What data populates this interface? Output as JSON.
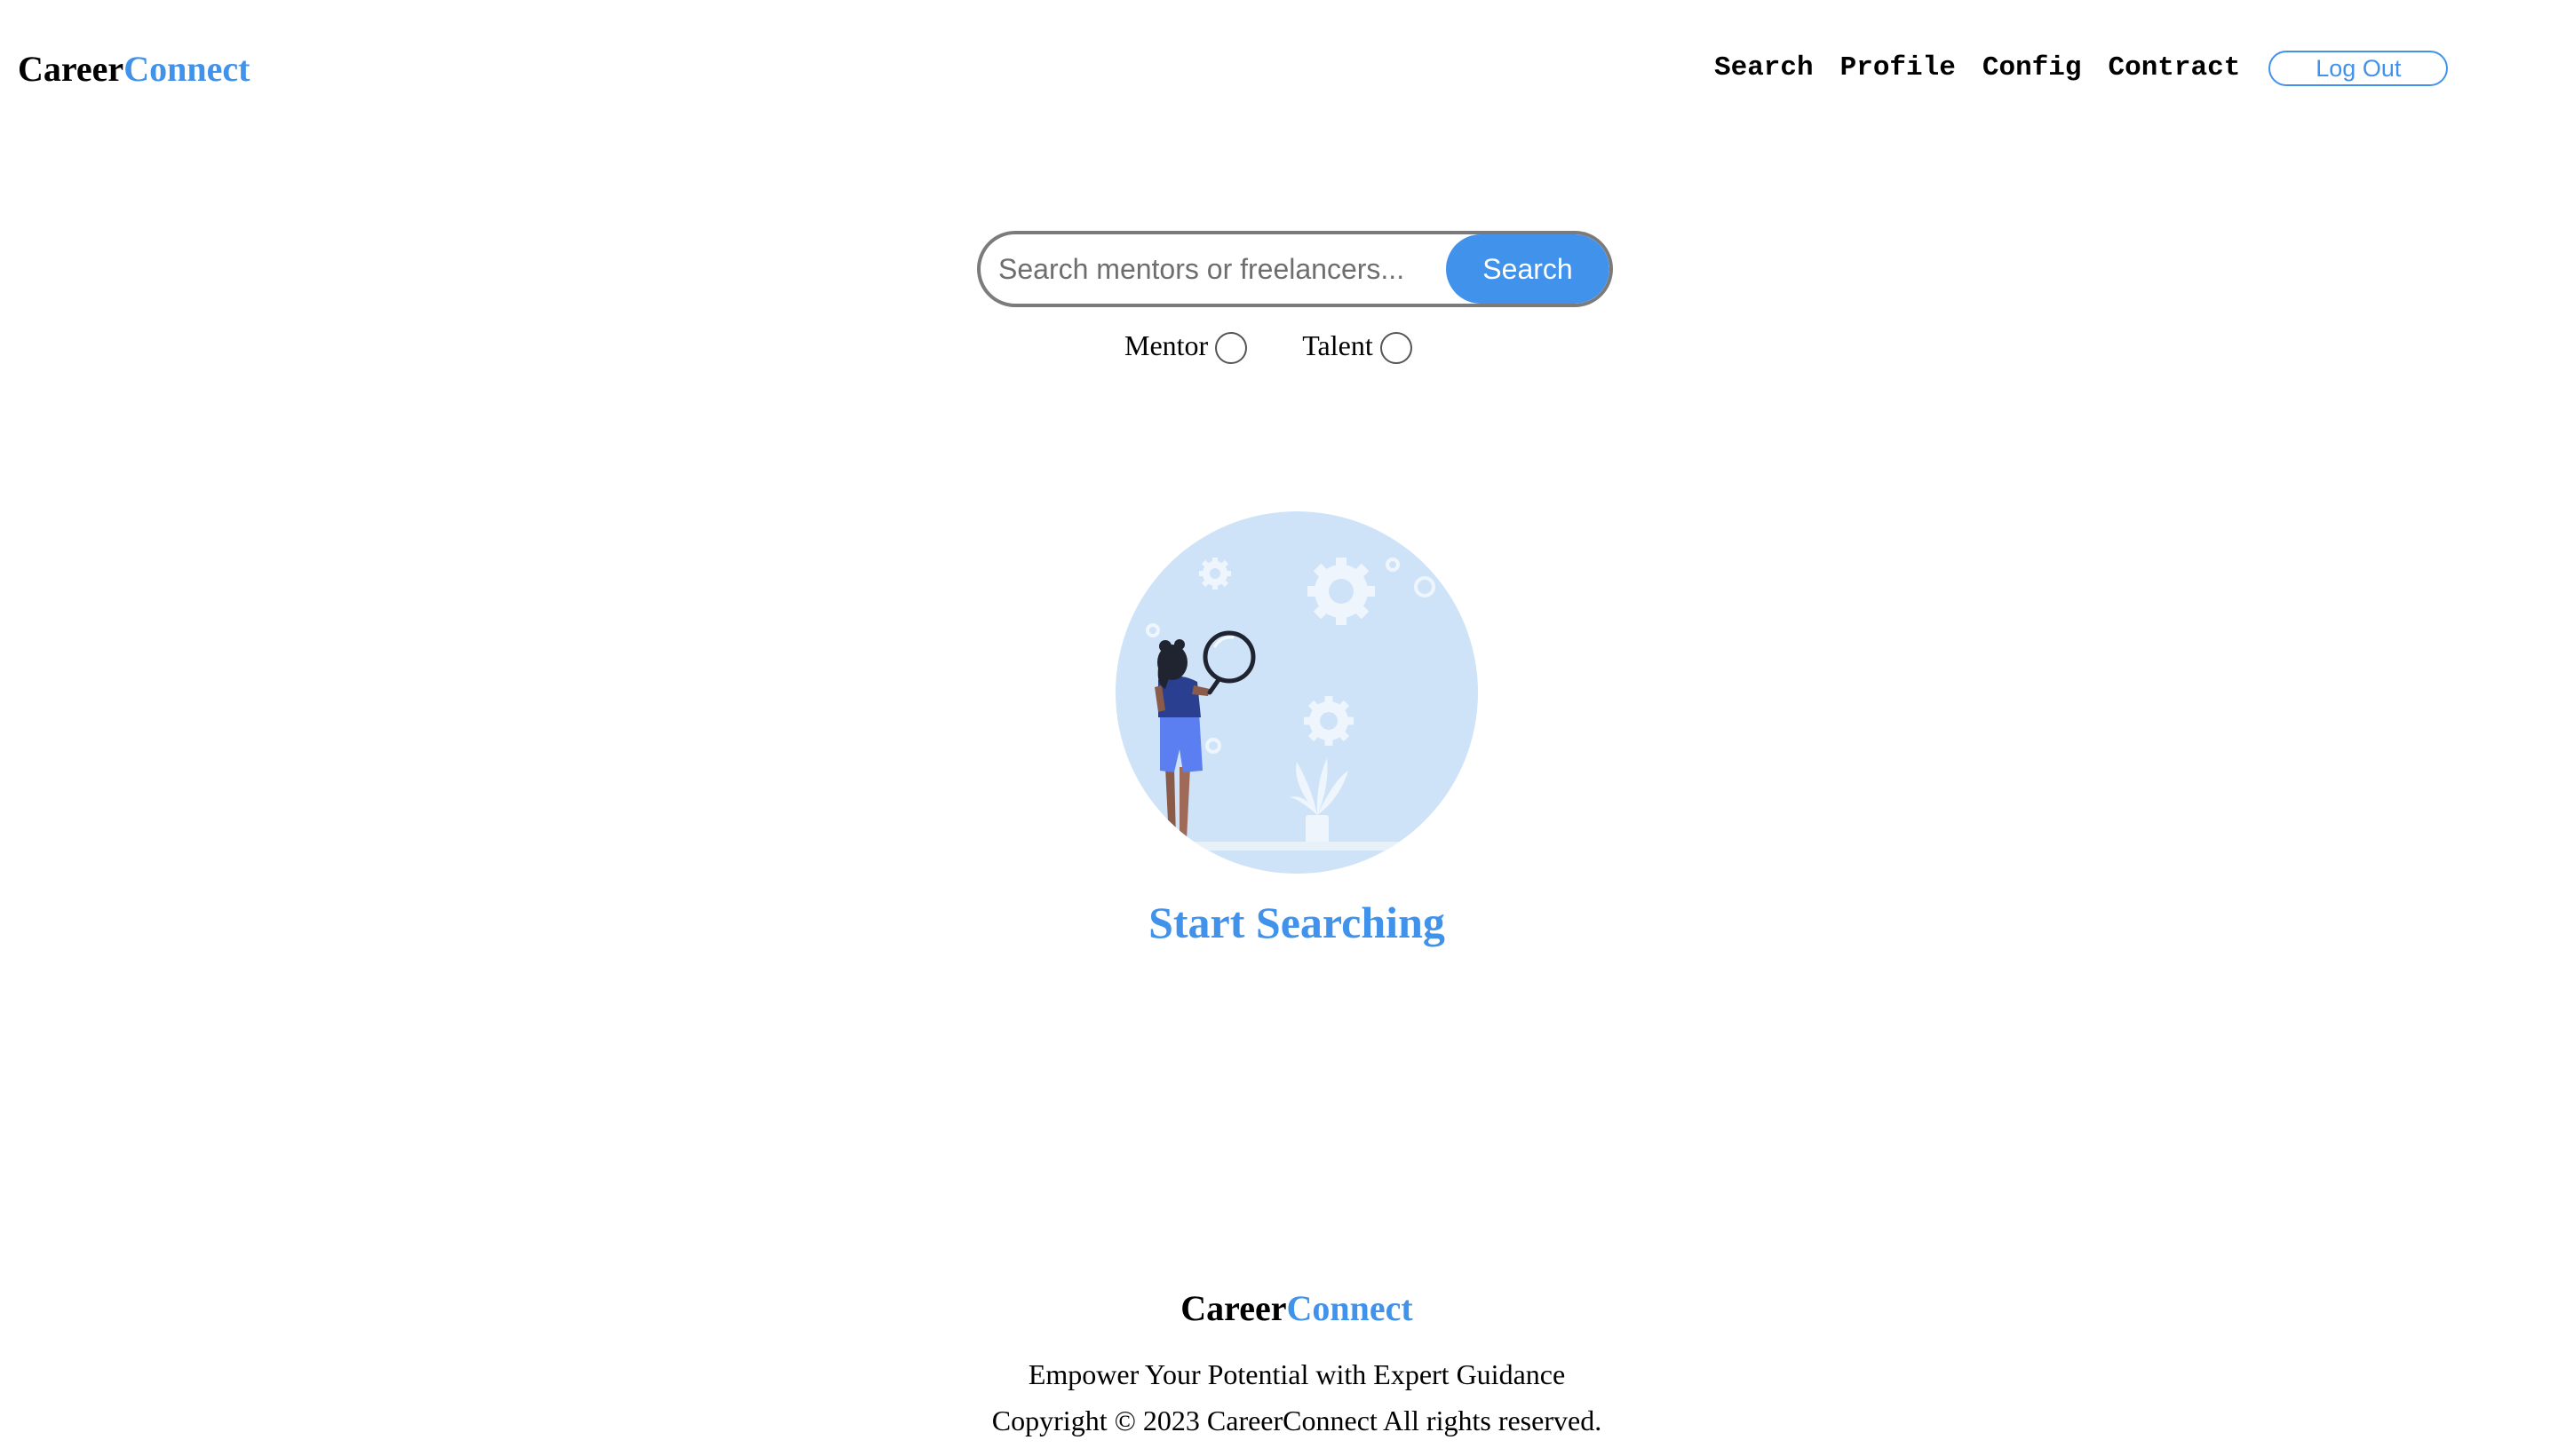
{
  "header": {
    "brand_part1": "Career",
    "brand_part2": "Connect",
    "nav": {
      "search": "Search",
      "profile": "Profile",
      "config": "Config",
      "contract": "Contract"
    },
    "logout_label": "Log Out"
  },
  "search": {
    "placeholder": "Search mentors or freelancers...",
    "value": "",
    "button_label": "Search",
    "filters": {
      "mentor_label": "Mentor",
      "talent_label": "Talent"
    }
  },
  "main": {
    "illustration_icon": "person-with-magnifying-glass-illustration",
    "heading": "Start Searching"
  },
  "footer": {
    "brand_part1": "Career",
    "brand_part2": "Connect",
    "tagline": "Empower Your Potential with Expert Guidance",
    "copyright": "Copyright © 2023 CareerConnect All rights reserved."
  },
  "colors": {
    "accent": "#4192ea",
    "illustration_bg": "#cfe3f8"
  }
}
